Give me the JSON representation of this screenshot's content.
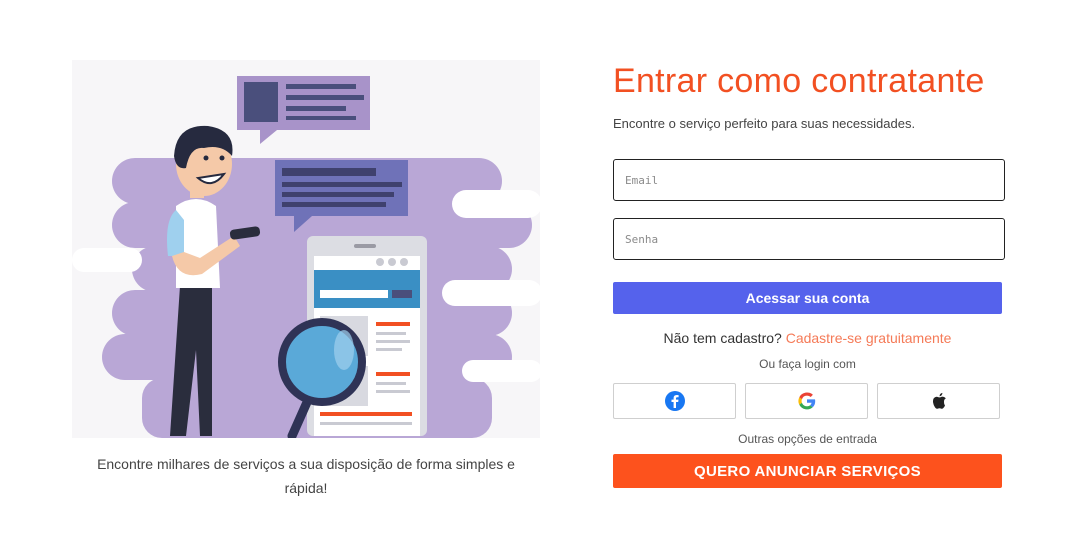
{
  "left_panel": {
    "caption": "Encontre milhares de serviços a sua disposição de forma simples e rápida!"
  },
  "login": {
    "title": "Entrar como contratante",
    "subtitle": "Encontre o serviço perfeito para suas necessidades.",
    "email_placeholder": "Email",
    "password_placeholder": "Senha",
    "submit_label": "Acessar sua conta",
    "no_account_text": "Não tem cadastro?",
    "signup_link": "Cadastre-se gratuitamente",
    "or_login_with": "Ou faça login com",
    "social": [
      {
        "icon": "facebook-icon",
        "color": "#1877f2"
      },
      {
        "icon": "google-icon",
        "color": "#4285f4"
      },
      {
        "icon": "apple-icon",
        "color": "#222222"
      }
    ],
    "other_options": "Outras opções de entrada",
    "cta_label": "QUERO ANUNCIAR SERVIÇOS"
  },
  "colors": {
    "accent": "#f25022",
    "primary_button": "#5562ec",
    "cta_button": "#fd521d",
    "link": "#f57a57",
    "illustration_blob": "#b9a7d6"
  }
}
